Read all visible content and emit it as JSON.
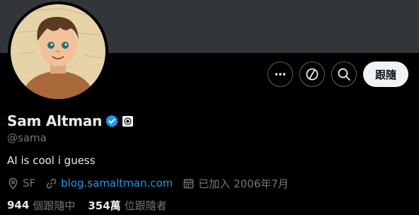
{
  "profile": {
    "name": "Sam Altman",
    "handle": "@sama",
    "bio": "AI is cool i guess",
    "location": "SF",
    "website": "blog.samaltman.com",
    "joined": "已加入 2006年7月"
  },
  "stats": {
    "following_count": "944",
    "following_label": "個跟隨中",
    "followers_count": "354萬",
    "followers_label": "位跟隨者"
  },
  "actions": {
    "follow_label": "跟隨"
  },
  "colors": {
    "banner": "#333639",
    "background": "#000000",
    "verified": "#1d9bf0",
    "link": "#1d9bf0",
    "muted": "#71767b",
    "button_bg": "#eff3f4"
  },
  "icons": {
    "more": "more-icon",
    "subscribe": "subscribe-icon",
    "search": "search-icon",
    "verified": "verified-badge-icon",
    "affiliation": "affiliation-icon",
    "location": "location-icon",
    "link": "link-icon",
    "calendar": "calendar-icon"
  }
}
